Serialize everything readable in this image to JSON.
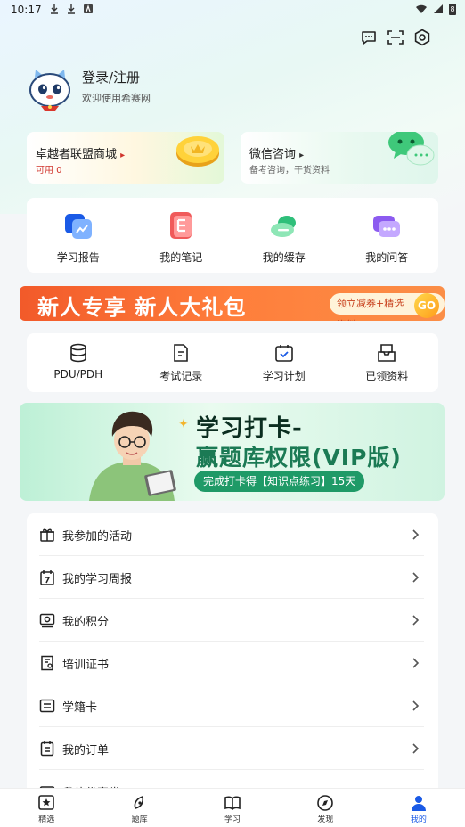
{
  "status_bar": {
    "time": "10:17",
    "battery_glyph": "8"
  },
  "profile": {
    "login_label": "登录/注册",
    "welcome_text": "欢迎使用希赛网"
  },
  "cards": [
    {
      "title": "卓越者联盟商城",
      "arrow": "▸",
      "sub": "可用 0",
      "sub_color": "#d0342c"
    },
    {
      "title": "微信咨询",
      "arrow": "▸",
      "sub": "备考咨询，干货资料",
      "sub_color": "#666666"
    }
  ],
  "quick_grid": [
    {
      "label": "学习报告",
      "icon": "report-icon"
    },
    {
      "label": "我的笔记",
      "icon": "notes-icon"
    },
    {
      "label": "我的缓存",
      "icon": "cache-cloud-icon"
    },
    {
      "label": "我的问答",
      "icon": "qa-icon"
    }
  ],
  "promo_banner": {
    "title": "新人专享 新人大礼包",
    "pill": "领立减券+精选资料",
    "go": "GO"
  },
  "tools_grid": [
    {
      "label": "PDU/PDH",
      "icon": "database-icon"
    },
    {
      "label": "考试记录",
      "icon": "exam-record-icon"
    },
    {
      "label": "学习计划",
      "icon": "study-plan-icon"
    },
    {
      "label": "已领资料",
      "icon": "inbox-icon"
    }
  ],
  "study_banner": {
    "line1": "学习打卡-",
    "line2": "赢题库权限(VIP版)",
    "pill": "完成打卡得【知识点练习】15天"
  },
  "menu": [
    {
      "label": "我参加的活动",
      "icon": "gift-icon"
    },
    {
      "label": "我的学习周报",
      "icon": "calendar-icon"
    },
    {
      "label": "我的积分",
      "icon": "points-icon"
    },
    {
      "label": "培训证书",
      "icon": "certificate-icon"
    },
    {
      "label": "学籍卡",
      "icon": "student-card-icon"
    },
    {
      "label": "我的订单",
      "icon": "order-icon"
    },
    {
      "label": "我的优惠券",
      "icon": "coupon-icon"
    }
  ],
  "tabs": [
    {
      "label": "精选",
      "icon": "featured-icon"
    },
    {
      "label": "题库",
      "icon": "question-bank-icon"
    },
    {
      "label": "学习",
      "icon": "book-icon"
    },
    {
      "label": "发现",
      "icon": "compass-icon"
    },
    {
      "label": "我的",
      "icon": "user-icon"
    }
  ],
  "colors": {
    "accent": "#1a5ae6",
    "promo_orange": "#f25a2a",
    "study_green": "#1f9a67"
  }
}
